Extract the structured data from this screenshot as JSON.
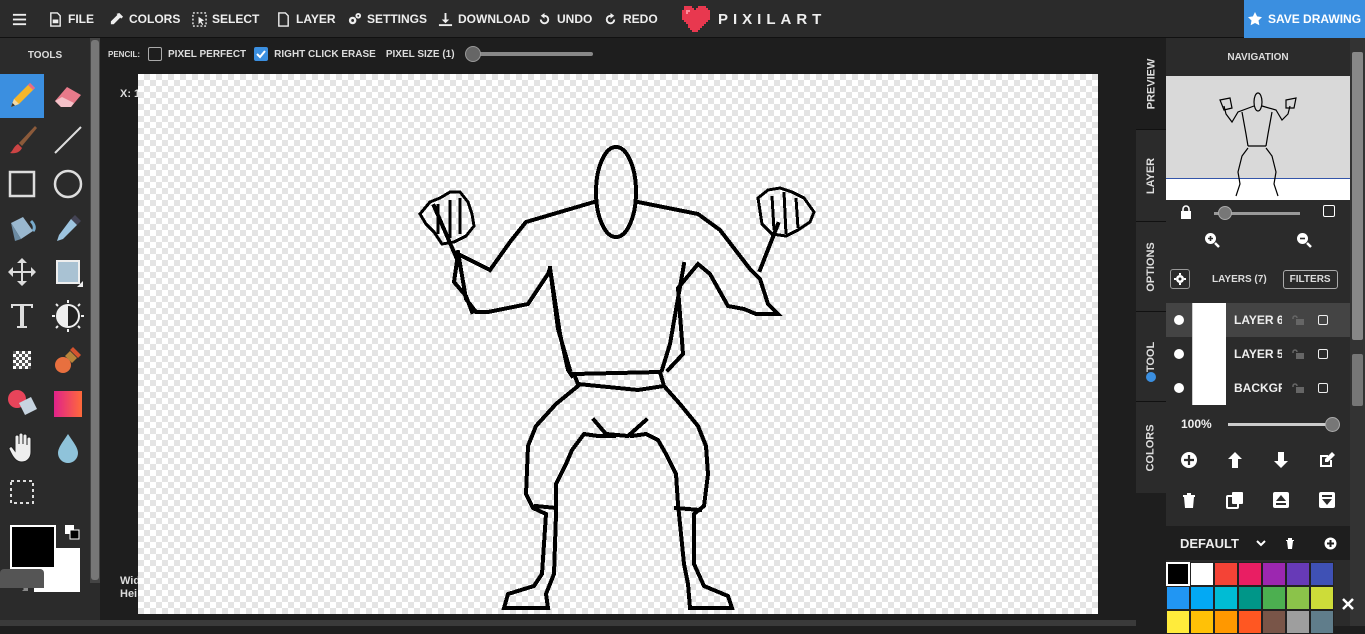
{
  "menu": {
    "file": "FILE",
    "colors": "COLORS",
    "select": "SELECT",
    "layer": "LAYER",
    "settings": "SETTINGS",
    "download": "DOWNLOAD",
    "undo": "UNDO",
    "redo": "REDO"
  },
  "brand": {
    "name": "PIXILART",
    "color": "#e8384f"
  },
  "save_label": "SAVE DRAWING",
  "accent": "#3b8fe0",
  "tools": {
    "title": "TOOLS",
    "active": "pencil",
    "items": [
      "pencil-icon",
      "eraser-icon",
      "brush-icon",
      "line-icon",
      "rectangle-icon",
      "ellipse-icon",
      "bucket-icon",
      "eyedropper-icon",
      "move-icon",
      "fill-rect-icon",
      "text-icon",
      "lighten-icon",
      "dither-icon",
      "stamp-icon",
      "color-replace-icon",
      "gradient-icon",
      "hand-icon",
      "drop-icon",
      "selection-icon"
    ],
    "primary_color": "#000000",
    "secondary_color": "#ffffff"
  },
  "options": {
    "tool_label": "PENCIL:",
    "pixel_perfect_label": "PIXEL PERFECT",
    "pixel_perfect": false,
    "right_click_erase_label": "RIGHT CLICK ERASE",
    "right_click_erase": true,
    "pixel_size_label": "PIXEL SIZE (1)"
  },
  "workspace": {
    "coords": "X: 1",
    "dims_line1": "Wid",
    "dims_line2": "Hei"
  },
  "side_tabs": [
    "PREVIEW",
    "LAYER",
    "OPTIONS",
    "TOOL",
    "COLORS"
  ],
  "navigation": {
    "title": "NAVIGATION"
  },
  "layers": {
    "title": "LAYERS (7)",
    "filters": "FILTERS",
    "rows": [
      {
        "name": "LAYER 6",
        "selected": true
      },
      {
        "name": "LAYER 5",
        "selected": false
      },
      {
        "name": "BACKGROUND",
        "selected": false
      }
    ],
    "opacity": "100%"
  },
  "palette": {
    "name": "DEFAULT",
    "colors": [
      "#000000",
      "#ffffff",
      "#f44336",
      "#e91e63",
      "#9c27b0",
      "#673ab7",
      "#3f51b5",
      "#2196f3",
      "#03a9f4",
      "#00bcd4",
      "#009688",
      "#4caf50",
      "#8bc34a",
      "#cddc39",
      "#ffeb3b",
      "#ffc107",
      "#ff9800",
      "#ff5722",
      "#795548",
      "#9e9e9e",
      "#607d8b"
    ]
  }
}
